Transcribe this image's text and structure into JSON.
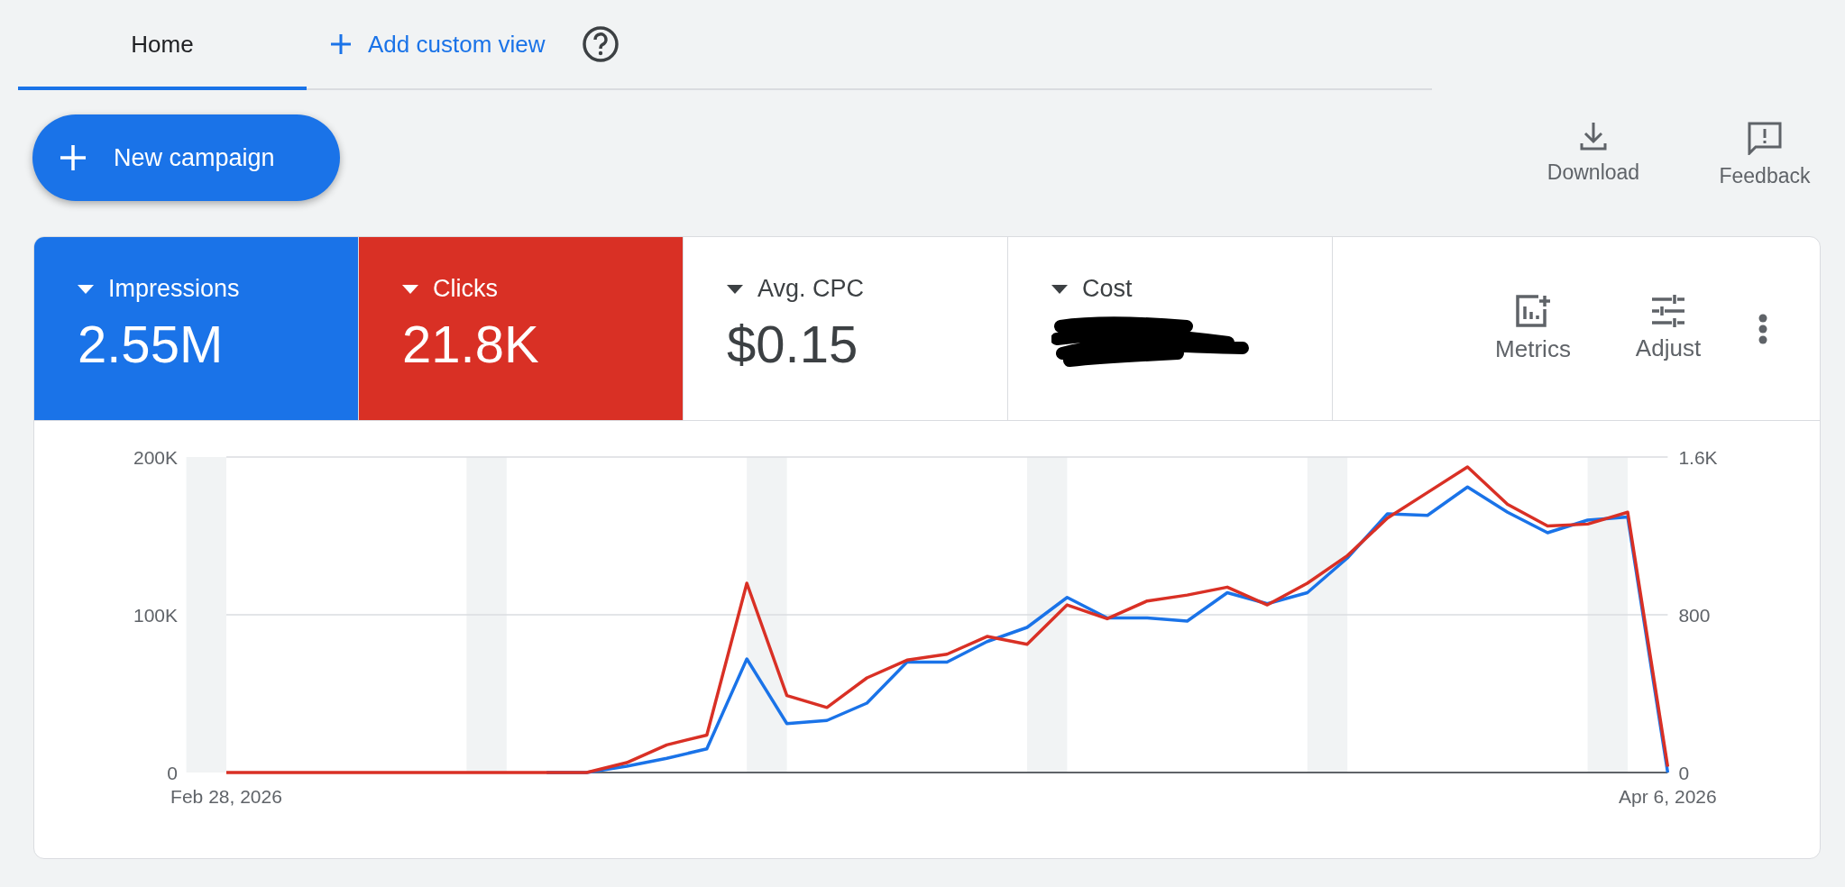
{
  "tabs": [
    {
      "label": "Home",
      "selected": true
    }
  ],
  "add_view": {
    "label": "Add custom view"
  },
  "new_campaign": {
    "label": "New campaign"
  },
  "actions": [
    {
      "kind": "download",
      "label": "Download"
    },
    {
      "kind": "feedback",
      "label": "Feedback"
    }
  ],
  "metrics": [
    {
      "label": "Impressions",
      "value": "2.55M",
      "selected": true,
      "color": "#1a73e8"
    },
    {
      "label": "Clicks",
      "value": "21.8K",
      "selected": true,
      "color": "#d93025"
    },
    {
      "label": "Avg. CPC",
      "value": "$0.15",
      "selected": false
    },
    {
      "label": "Cost",
      "redacted": true,
      "selected": false
    }
  ],
  "tools": [
    {
      "kind": "metrics",
      "label": "Metrics"
    },
    {
      "kind": "adjust",
      "label": "Adjust"
    },
    {
      "kind": "more"
    }
  ],
  "chart_data": {
    "type": "line",
    "categories": [
      "Feb 28, 2026",
      null,
      null,
      null,
      null,
      null,
      null,
      null,
      null,
      null,
      null,
      null,
      null,
      null,
      null,
      null,
      null,
      null,
      null,
      null,
      null,
      null,
      null,
      null,
      null,
      null,
      null,
      null,
      null,
      null,
      null,
      null,
      null,
      null,
      null,
      null,
      "Apr 6, 2026"
    ],
    "ylim": [
      0,
      200000
    ],
    "yticks": [
      {
        "value": 0,
        "label": "0"
      },
      {
        "value": 100000,
        "label": "100K"
      },
      {
        "value": 200000,
        "label": "200K"
      }
    ],
    "y2lim": [
      0,
      1600
    ],
    "y2ticks": [
      {
        "value": 0,
        "label": "0"
      },
      {
        "value": 800,
        "label": "800"
      },
      {
        "value": 1600,
        "label": "1.6K"
      }
    ],
    "series": [
      {
        "color": "#1a73e8",
        "values": [
          null,
          null,
          null,
          null,
          null,
          null,
          null,
          null,
          0,
          0,
          4000,
          9000,
          15000,
          72000,
          31000,
          33000,
          44000,
          70000,
          70000,
          83000,
          92000,
          111000,
          98000,
          98000,
          96000,
          114000,
          107000,
          114000,
          136000,
          164000,
          163000,
          181000,
          165000,
          152000,
          160000,
          162000,
          0
        ]
      },
      {
        "color": "#d93025",
        "axis": "y2",
        "values": [
          0,
          0,
          0,
          0,
          0,
          0,
          0,
          0,
          0,
          0,
          50,
          140,
          190,
          960,
          390,
          330,
          480,
          570,
          600,
          690,
          650,
          850,
          780,
          870,
          900,
          940,
          850,
          960,
          1100,
          1290,
          1420,
          1550,
          1360,
          1250,
          1260,
          1320,
          30
        ]
      }
    ]
  }
}
